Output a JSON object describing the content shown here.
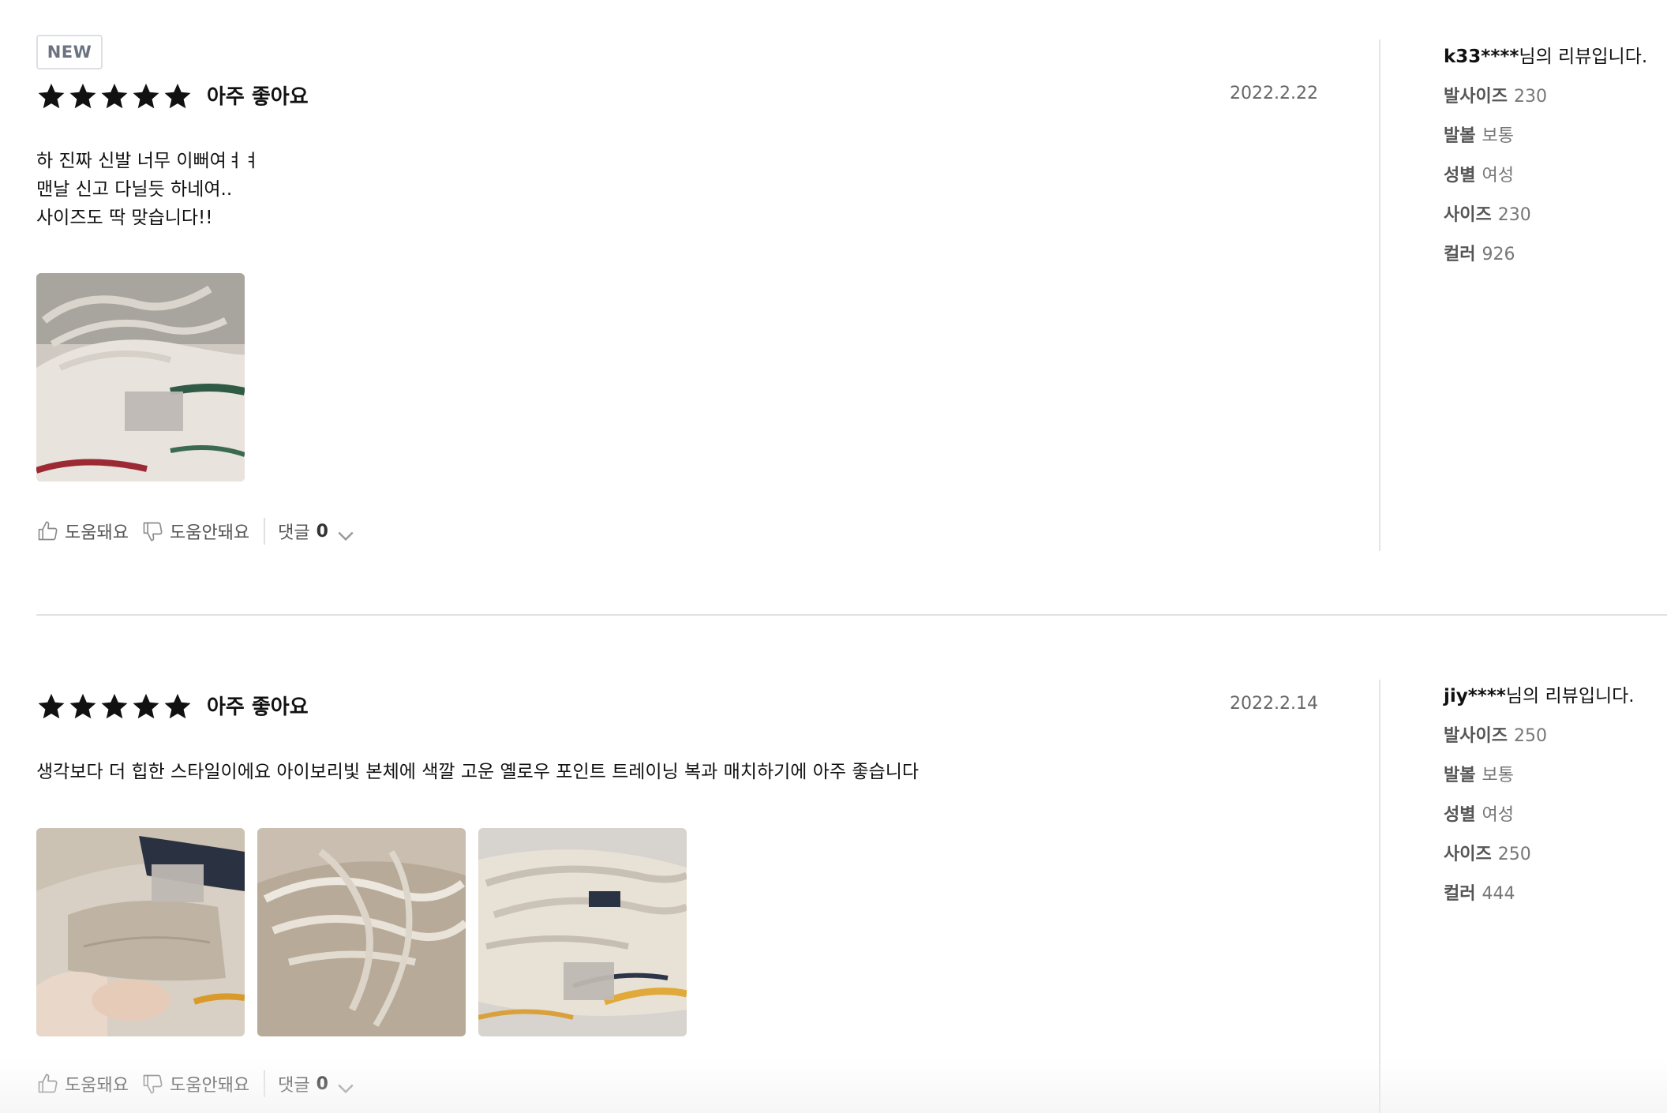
{
  "reviews": [
    {
      "badge": "NEW",
      "rating": 5,
      "rating_max": 5,
      "rating_text": "아주 좋아요",
      "date": "2022.2.22",
      "content_lines": [
        "하 진짜 신발 너무 이뻐여ㅕㅕ",
        "맨날 신고 다닐듯 하네여..",
        "사이즈도 딱 맞습니다!!"
      ],
      "photo_count": 1,
      "actions": {
        "helpful": "도움돼요",
        "not_helpful": "도움안돼요",
        "comment_label": "댓글",
        "comment_count": "0"
      },
      "author_id": "k33****",
      "author_suffix": "님의 리뷰입니다.",
      "attributes": [
        {
          "label": "발사이즈",
          "value": "230"
        },
        {
          "label": "발볼",
          "value": "보통"
        },
        {
          "label": "성별",
          "value": "여성"
        },
        {
          "label": "사이즈",
          "value": "230"
        },
        {
          "label": "컬러",
          "value": "926"
        }
      ]
    },
    {
      "rating": 5,
      "rating_max": 5,
      "rating_text": "아주 좋아요",
      "date": "2022.2.14",
      "content_lines": [
        "생각보다 더 힙한 스타일이에요 아이보리빛 본체에 색깔 고운 옐로우 포인트 트레이닝 복과 매치하기에 아주 좋습니다"
      ],
      "photo_count": 3,
      "actions": {
        "helpful": "도움돼요",
        "not_helpful": "도움안돼요",
        "comment_label": "댓글",
        "comment_count": "0"
      },
      "author_id": "jiy****",
      "author_suffix": "님의 리뷰입니다.",
      "attributes": [
        {
          "label": "발사이즈",
          "value": "250"
        },
        {
          "label": "발볼",
          "value": "보통"
        },
        {
          "label": "성별",
          "value": "여성"
        },
        {
          "label": "사이즈",
          "value": "250"
        },
        {
          "label": "컬러",
          "value": "444"
        }
      ]
    }
  ],
  "colors": {
    "star": "#111111",
    "badge_border": "#dcdfe6",
    "divider": "#e2e2e2",
    "muted_text": "#777777"
  }
}
